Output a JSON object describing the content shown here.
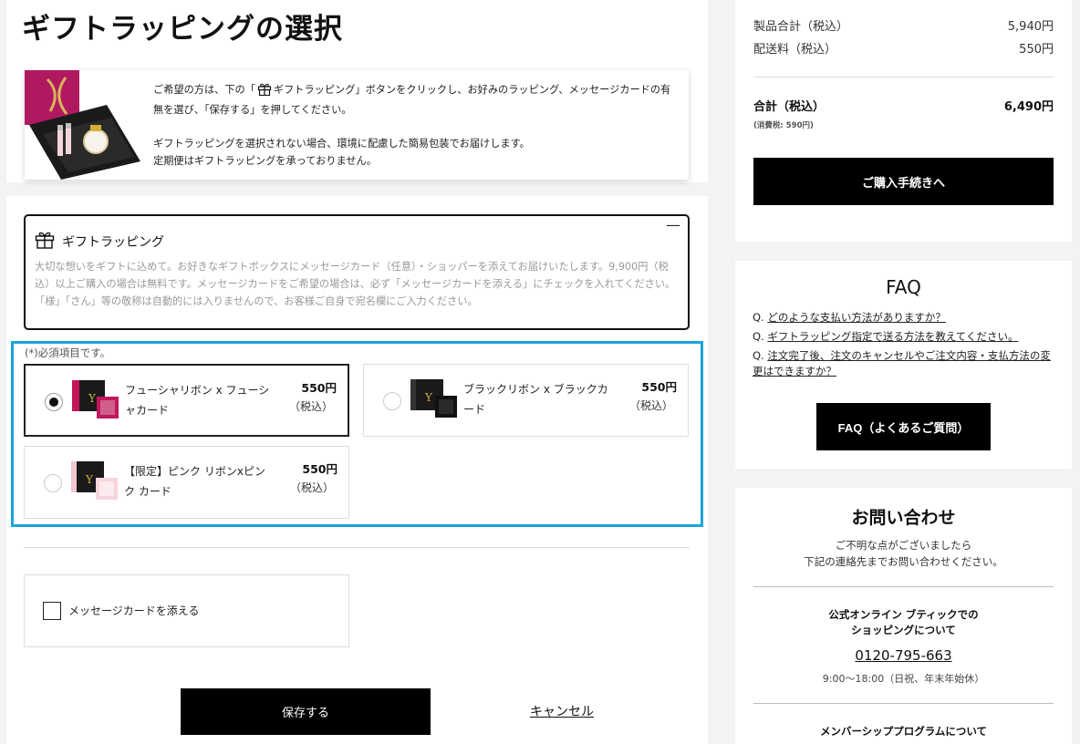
{
  "page": {
    "title": "ギフトラッピングの選択"
  },
  "intro": {
    "line1_prefix": "ご希望の方は、下の「",
    "line1_suffix": "ギフトラッピング」ボタンをクリックし、お好みのラッピング、メッセージカードの有無を選び、「保存する」を押してください。",
    "line2": "ギフトラッピングを選択されない場合、環境に配慮した簡易包装でお届けします。",
    "line3": "定期便はギフトラッピングを承っておりません。"
  },
  "wrapping": {
    "title": "ギフトラッピング",
    "collapse_symbol": "—",
    "description": "大切な想いをギフトに込めて。お好きなギフトボックスにメッセージカード（任意）・ショッパーを添えてお届けいたします。9,900円（税込）以上ご購入の場合は無料です。メッセージカードをご希望の場合は、必ず「メッセージカードを添える」にチェックを入れてください。「様」「さん」等の敬称は自動的には入りませんので、お客様ご自身で宛名欄にご入力ください。",
    "required_note": "(*)必須項目です。",
    "options": [
      {
        "name": "フューシャリボン x フューシャカード",
        "price": "550円",
        "tax": "（税込）",
        "selected": true,
        "accent": "#c2185b"
      },
      {
        "name": "ブラックリボン x ブラックカード",
        "price": "550円",
        "tax": "（税込）",
        "selected": false,
        "accent": "#111111"
      },
      {
        "name": "【限定】ピンク リボンxピンク カード",
        "price": "550円",
        "tax": "（税込）",
        "selected": false,
        "accent": "#f4c6cf"
      }
    ],
    "message_card_label": "メッセージカードを添える",
    "save_label": "保存する",
    "cancel_label": "キャンセル"
  },
  "summary": {
    "subtotal_label": "製品合計（税込）",
    "subtotal_value": "5,940円",
    "shipping_label": "配送料（税込）",
    "shipping_value": "550円",
    "total_label": "合計（税込）",
    "total_value": "6,490円",
    "tax_note": "(消費税: 590円)",
    "checkout_label": "ご購入手続きへ"
  },
  "faq": {
    "title": "FAQ",
    "items": [
      {
        "prefix": "Q.",
        "text": "どのような支払い方法がありますか？"
      },
      {
        "prefix": "Q.",
        "text": "ギフトラッピング指定で送る方法を教えてください。"
      },
      {
        "prefix": "Q.",
        "text": "注文完了後、注文のキャンセルやご注文内容・支払方法の変更はできますか？"
      }
    ],
    "button_label": "FAQ（よくあるご質問）"
  },
  "contact": {
    "title": "お問い合わせ",
    "lead_line1": "ご不明な点がございましたら",
    "lead_line2": "下記の連絡先までお問い合わせください。",
    "sub_line1": "公式オンライン ブティックでの",
    "sub_line2": "ショッピングについて",
    "phone": "0120-795-663",
    "hours": "9:00〜18:00（日祝、年末年始休）",
    "member": "メンバーシッププログラムについて"
  },
  "colors": {
    "selection_border": "#1ba3da",
    "button_bg": "#000000",
    "brand_pink": "#c2185b"
  }
}
